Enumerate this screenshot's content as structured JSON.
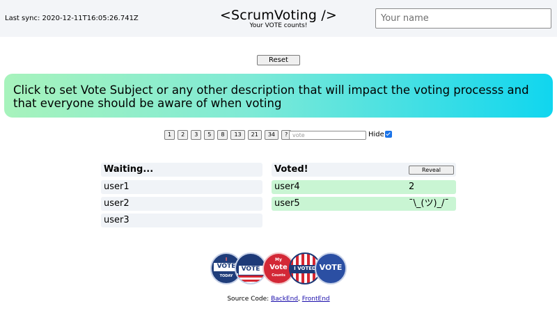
{
  "header": {
    "sync_label": "Last sync:",
    "sync_time": "2020-12-11T16:05:26.741Z",
    "title": "<ScrumVoting />",
    "tagline": "Your VOTE counts!",
    "name_placeholder": "Your name"
  },
  "controls": {
    "reset_label": "Reset",
    "subject_text": "Click to set Vote Subject or any other description that will impact the voting processs and that everyone should be aware of when voting",
    "cards": [
      "1",
      "2",
      "3",
      "5",
      "8",
      "13",
      "21",
      "34",
      "?"
    ],
    "vote_placeholder": "vote",
    "hide_label": "Hide",
    "hide_checked": true
  },
  "waiting": {
    "heading": "Waiting...",
    "users": [
      "user1",
      "user2",
      "user3"
    ]
  },
  "voted": {
    "heading": "Voted!",
    "reveal_label": "Reveal",
    "rows": [
      {
        "user": "user4",
        "vote": "2"
      },
      {
        "user": "user5",
        "vote": "¯\\_(ツ)_/¯"
      }
    ]
  },
  "badges": {
    "b1_top": "I",
    "b1_main": "VOTE",
    "b1_sub": "TODAY",
    "b2_main": "VOTE",
    "b3_top": "My",
    "b3_main": "Vote",
    "b3_sub": "Counts",
    "b4_main": "I VOTED",
    "b5_main": "VOTE"
  },
  "footer": {
    "prefix": "Source Code:",
    "backend": "BackEnd",
    "separator": ",",
    "frontend": "FrontEnd"
  },
  "colors": {
    "accent_blue": "#1a73e8",
    "voted_green": "#c9f5d3",
    "list_gray": "#f0f3f7"
  }
}
